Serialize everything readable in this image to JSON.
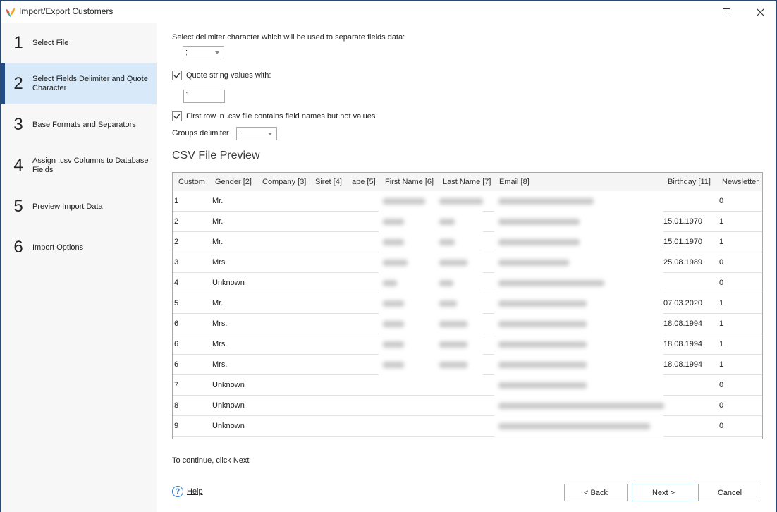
{
  "window": {
    "title": "Import/Export Customers",
    "maximize_icon": "maximize-icon",
    "close_icon": "close-icon"
  },
  "sidebar": {
    "active_index": 1,
    "accent_color": "#1f4b86",
    "active_bg": "#d8eaf9",
    "steps": [
      {
        "num": "1",
        "label": "Select File"
      },
      {
        "num": "2",
        "label": "Select Fields Delimiter and Quote Character"
      },
      {
        "num": "3",
        "label": "Base Formats and Separators"
      },
      {
        "num": "4",
        "label": "Assign .csv Columns to Database Fields"
      },
      {
        "num": "5",
        "label": "Preview Import Data"
      },
      {
        "num": "6",
        "label": "Import Options"
      }
    ]
  },
  "form": {
    "delimiter_label": "Select delimiter character which will be used to separate fields data:",
    "delimiter_value": ";",
    "quote_checkbox_label": "Quote string values with:",
    "quote_checked": true,
    "quote_value": "\"",
    "first_row_label": "First row in .csv file contains field names but not values",
    "first_row_checked": true,
    "groups_delimiter_label": "Groups delimiter",
    "groups_delimiter_value": ";"
  },
  "preview": {
    "title": "CSV File Preview",
    "columns": [
      "Custom",
      "Gender [2]",
      "Company [3]",
      "Siret [4]",
      "ape [5]",
      "First Name [6]",
      "Last Name [7]",
      "Email [8]",
      "Birthday [11]",
      "Newsletter"
    ],
    "rows": [
      {
        "id": "1",
        "gender": "Mr.",
        "first": "[blurred]",
        "last": "[blurred]",
        "email": "[blurred]",
        "birthday": "",
        "newsletter": "0"
      },
      {
        "id": "2",
        "gender": "Mr.",
        "first": "[blurred]",
        "last": "[blurred]",
        "email": "[blurred]",
        "birthday": "15.01.1970",
        "newsletter": "1"
      },
      {
        "id": "2",
        "gender": "Mr.",
        "first": "[blurred]",
        "last": "[blurred]",
        "email": "[blurred]",
        "birthday": "15.01.1970",
        "newsletter": "1"
      },
      {
        "id": "3",
        "gender": "Mrs.",
        "first": "[blurred]",
        "last": "[blurred]",
        "email": "[blurred]",
        "birthday": "25.08.1989",
        "newsletter": "0"
      },
      {
        "id": "4",
        "gender": "Unknown",
        "first": "[blurred]",
        "last": "[blurred]",
        "email": "[blurred]",
        "birthday": "",
        "newsletter": "0"
      },
      {
        "id": "5",
        "gender": "Mr.",
        "first": "[blurred]",
        "last": "[blurred]",
        "email": "[blurred]",
        "birthday": "07.03.2020",
        "newsletter": "1"
      },
      {
        "id": "6",
        "gender": "Mrs.",
        "first": "[blurred]",
        "last": "[blurred]",
        "email": "[blurred]",
        "birthday": "18.08.1994",
        "newsletter": "1"
      },
      {
        "id": "6",
        "gender": "Mrs.",
        "first": "[blurred]",
        "last": "[blurred]",
        "email": "[blurred]",
        "birthday": "18.08.1994",
        "newsletter": "1"
      },
      {
        "id": "6",
        "gender": "Mrs.",
        "first": "[blurred]",
        "last": "[blurred]",
        "email": "[blurred]",
        "birthday": "18.08.1994",
        "newsletter": "1"
      },
      {
        "id": "7",
        "gender": "Unknown",
        "first": "",
        "last": "",
        "email": "[blurred]",
        "birthday": "",
        "newsletter": "0"
      },
      {
        "id": "8",
        "gender": "Unknown",
        "first": "",
        "last": "",
        "email": "[blurred]",
        "birthday": "",
        "newsletter": "0"
      },
      {
        "id": "9",
        "gender": "Unknown",
        "first": "",
        "last": "",
        "email": "[blurred]",
        "birthday": "",
        "newsletter": "0"
      }
    ]
  },
  "footer": {
    "hint": "To continue, click Next",
    "help_label": "Help",
    "back_label": "< Back",
    "next_label": "Next >",
    "cancel_label": "Cancel"
  }
}
